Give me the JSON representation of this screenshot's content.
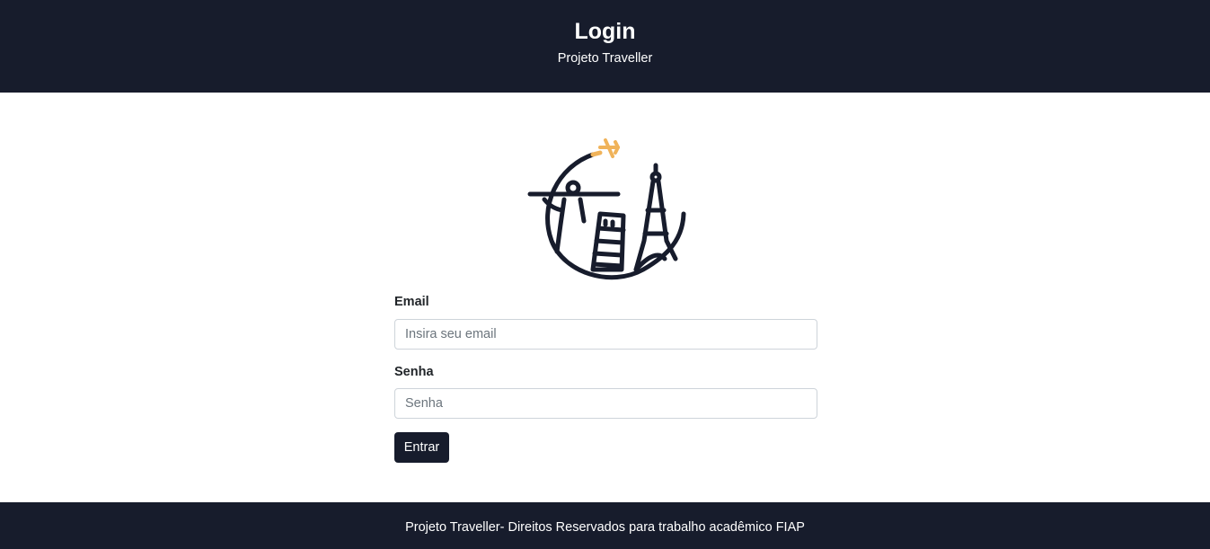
{
  "header": {
    "title": "Login",
    "subtitle": "Projeto Traveller"
  },
  "logo": {
    "icon": "travel-landmarks-logo",
    "colors": {
      "primary": "#171c2c",
      "accent": "#f0b35a"
    }
  },
  "form": {
    "email_label": "Email",
    "email_placeholder": "Insira seu email",
    "email_value": "",
    "password_label": "Senha",
    "password_placeholder": "Senha",
    "password_value": "",
    "submit_label": "Entrar"
  },
  "footer": {
    "text": "Projeto Traveller- Direitos Reservados para trabalho acadêmico FIAP"
  },
  "theme": {
    "dark": "#171c2c",
    "background": "#ffffff",
    "input_border": "#ced4da"
  }
}
